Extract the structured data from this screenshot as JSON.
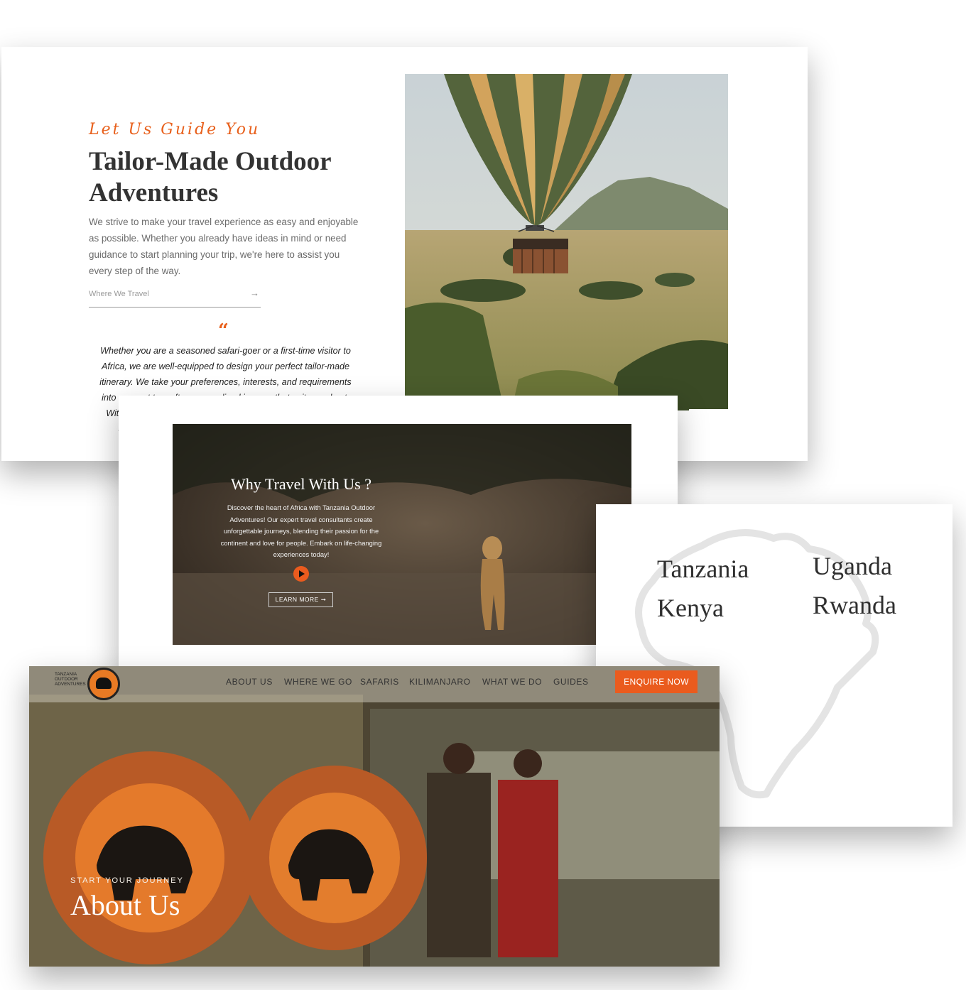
{
  "tailor_section": {
    "tagline": "Let Us Guide You",
    "title": "Tailor-Made Outdoor Adventures",
    "intro": "We strive to make your travel experience as easy and enjoyable as possible. Whether you already have ideas in mind or need guidance to start planning your trip, we're here to assist you every step of the way.",
    "link_label": "Where We Travel",
    "link_arrow": "→",
    "quote_mark": "“",
    "quote": "Whether you are a seasoned safari-goer or a first-time visitor to Africa, we are well-equipped to design your perfect tailor-made itinerary. We take your preferences, interests, and requirements into account to craft a personalized journey that suits you best. With our expertise and local knowledge, we ensure that your adventure in Africa becomes a truly unforgettable one."
  },
  "why_section": {
    "title": "Why Travel With Us ?",
    "text": "Discover the heart of Africa with Tanzania Outdoor Adventures! Our expert travel consultants create unforgettable journeys, blending their passion for the continent and love for people. Embark on life-changing experiences today!",
    "play_icon": "play-icon",
    "button_label": "LEARN MORE ➞"
  },
  "countries": [
    "Tanzania",
    "Kenya",
    "Uganda",
    "Rwanda"
  ],
  "about_section": {
    "logo_text": [
      "TANZANIA",
      "OUTDOOR",
      "ADVENTURES"
    ],
    "nav": [
      "ABOUT US",
      "WHERE WE GO",
      "SAFARIS",
      "KILIMANJARO",
      "WHAT WE DO",
      "GUIDES"
    ],
    "cta_label": "ENQUIRE NOW",
    "kicker": "START YOUR JOURNEY",
    "title": "About Us"
  },
  "colors": {
    "accent": "#ea5b1e",
    "heading": "#333333",
    "body_text": "#6b6b6b"
  }
}
